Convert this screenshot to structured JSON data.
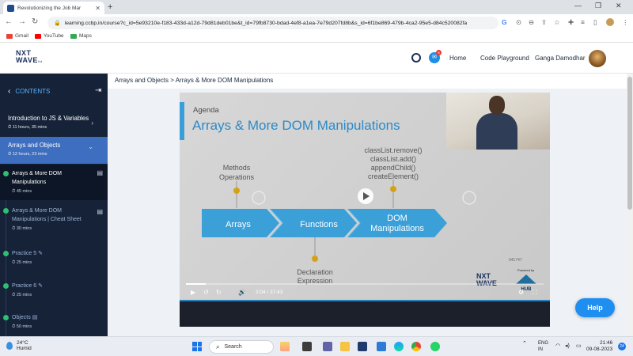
{
  "browser": {
    "tab_title": "Revolutionizing the Job Mar",
    "url": "learning.ccbp.in/course?c_id=5e93210e-f183-433d-a12d-79d81deb01be&t_id=79fb8730-bdad-4ef8-a1ea-7e79d207fd8b&s_id=6f1be869-479b-4ca2-95e5-d84c520082fa",
    "bookmarks": [
      {
        "label": "Gmail"
      },
      {
        "label": "YouTube"
      },
      {
        "label": "Maps"
      }
    ]
  },
  "header": {
    "logo_line1": "NXT",
    "logo_line2": "WAVE",
    "logo_sub": "ltd.",
    "chat_badge": "6",
    "links": [
      "Home",
      "Code Playground"
    ],
    "user_name": "Ganga Damodhar"
  },
  "sidebar": {
    "contents_label": "CONTENTS",
    "courses": [
      {
        "title": "Introduction to JS & Variables",
        "duration": "11 hours, 35 mins"
      },
      {
        "title": "Arrays and Objects",
        "duration": "12 hours, 23 mins"
      }
    ],
    "sessions": [
      {
        "title": "Arrays & More DOM Manipulations",
        "duration": "45 mins"
      },
      {
        "title": "Arrays & More DOM Manipulations | Cheat Sheet",
        "duration": "30 mins"
      },
      {
        "title": "Practice 5",
        "duration": "25 mins"
      },
      {
        "title": "Practice 6",
        "duration": "25 mins"
      },
      {
        "title": "Objects",
        "duration": "50 mins"
      }
    ]
  },
  "breadcrumb": "Arrays and Objects > Arrays & More DOM Manipulations",
  "slide": {
    "agenda": "Agenda",
    "title": "Arrays & More DOM Manipulations",
    "methods_line1": "Methods",
    "methods_line2": "Operations",
    "dom_methods": [
      "classList.remove()",
      "classList.add()",
      "appendChild()",
      "createElement()"
    ],
    "stages": [
      "Arrays",
      "Functions",
      "DOM Manipulations"
    ],
    "declaration_line1": "Declaration",
    "declaration_line2": "Expression",
    "video_id": "041747",
    "powered_by": "Powered by",
    "brand_logo_line1": "NXT",
    "brand_logo_line2": "WAVE",
    "partner_label": "HUB"
  },
  "player": {
    "current_time": "2:04",
    "separator": "/",
    "total_time": "37:43",
    "progress_fraction": 0.055
  },
  "help_label": "Help",
  "taskbar": {
    "temperature": "24°C",
    "weather": "Humid",
    "search_label": "Search",
    "lang_line1": "ENG",
    "lang_line2": "IN",
    "time": "21:46",
    "date": "09-08-2023",
    "notification_count": "24"
  }
}
